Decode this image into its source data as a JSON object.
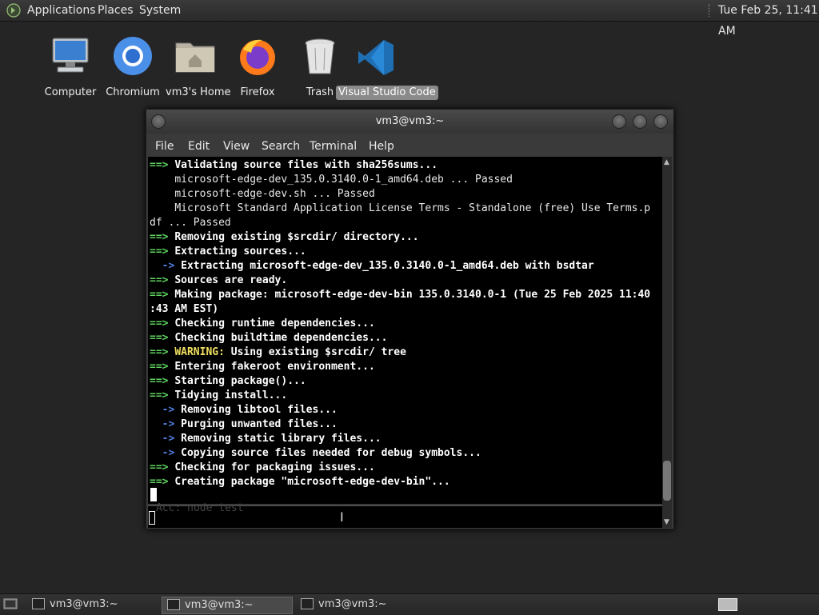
{
  "top_panel": {
    "menu": [
      "Applications",
      "Places",
      "System"
    ],
    "clock": "Tue Feb 25, 11:41 AM"
  },
  "desktop_icons": [
    {
      "label": "Computer",
      "icon": "computer-icon"
    },
    {
      "label": "Chromium",
      "icon": "chromium-icon"
    },
    {
      "label": "vm3's Home",
      "icon": "home-folder-icon"
    },
    {
      "label": "Firefox",
      "icon": "firefox-icon"
    },
    {
      "label": "Trash",
      "icon": "trash-icon"
    },
    {
      "label": "Visual Studio Code",
      "icon": "vscode-icon"
    }
  ],
  "terminal": {
    "title": "vm3@vm3:~",
    "menu": [
      "File",
      "Edit",
      "View",
      "Search",
      "Terminal",
      "Help"
    ],
    "lines": [
      {
        "prefix": "==> ",
        "kind": "g",
        "text": "Validating source files with sha256sums...",
        "bold": true
      },
      {
        "prefix": "    ",
        "kind": "",
        "text": "microsoft-edge-dev_135.0.3140.0-1_amd64.deb ... Passed",
        "bold": false
      },
      {
        "prefix": "    ",
        "kind": "",
        "text": "microsoft-edge-dev.sh ... Passed",
        "bold": false
      },
      {
        "prefix": "    ",
        "kind": "",
        "text": "Microsoft Standard Application License Terms - Standalone (free) Use Terms.p",
        "bold": false
      },
      {
        "prefix": "",
        "kind": "",
        "text": "df ... Passed",
        "bold": false
      },
      {
        "prefix": "==> ",
        "kind": "g",
        "text": "Removing existing $srcdir/ directory...",
        "bold": true
      },
      {
        "prefix": "==> ",
        "kind": "g",
        "text": "Extracting sources...",
        "bold": true
      },
      {
        "prefix": "  -> ",
        "kind": "b",
        "text": "Extracting microsoft-edge-dev_135.0.3140.0-1_amd64.deb with bsdtar",
        "bold": true
      },
      {
        "prefix": "==> ",
        "kind": "g",
        "text": "Sources are ready.",
        "bold": true
      },
      {
        "prefix": "==> ",
        "kind": "g",
        "text": "Making package: microsoft-edge-dev-bin 135.0.3140.0-1 (Tue 25 Feb 2025 11:40",
        "bold": true
      },
      {
        "prefix": "",
        "kind": "",
        "text": ":43 AM EST)",
        "bold": true
      },
      {
        "prefix": "==> ",
        "kind": "g",
        "text": "Checking runtime dependencies...",
        "bold": true
      },
      {
        "prefix": "==> ",
        "kind": "g",
        "text": "Checking buildtime dependencies...",
        "bold": true
      },
      {
        "prefix": "==> ",
        "kind": "g",
        "warn": "WARNING:",
        "text": " Using existing $srcdir/ tree",
        "bold": true
      },
      {
        "prefix": "==> ",
        "kind": "g",
        "text": "Entering fakeroot environment...",
        "bold": true
      },
      {
        "prefix": "==> ",
        "kind": "g",
        "text": "Starting package()...",
        "bold": true
      },
      {
        "prefix": "==> ",
        "kind": "g",
        "text": "Tidying install...",
        "bold": true
      },
      {
        "prefix": "  -> ",
        "kind": "b",
        "text": "Removing libtool files...",
        "bold": true
      },
      {
        "prefix": "  -> ",
        "kind": "b",
        "text": "Purging unwanted files...",
        "bold": true
      },
      {
        "prefix": "  -> ",
        "kind": "b",
        "text": "Removing static library files...",
        "bold": true
      },
      {
        "prefix": "  -> ",
        "kind": "b",
        "text": "Copying source files needed for debug symbols...",
        "bold": true
      },
      {
        "prefix": "==> ",
        "kind": "g",
        "text": "Checking for packaging issues...",
        "bold": true
      },
      {
        "prefix": "==> ",
        "kind": "g",
        "text": "Creating package \"microsoft-edge-dev-bin\"...",
        "bold": true
      }
    ],
    "lower_pane_ghost": "Acc: node test"
  },
  "taskbar": {
    "tasks": [
      "vm3@vm3:~",
      "vm3@vm3:~",
      "vm3@vm3:~"
    ],
    "active_index": 1
  },
  "colors": {
    "arrow_green": "#5fd35f",
    "arrow_blue": "#4f7fe0",
    "warning_yellow": "#f0e060"
  }
}
